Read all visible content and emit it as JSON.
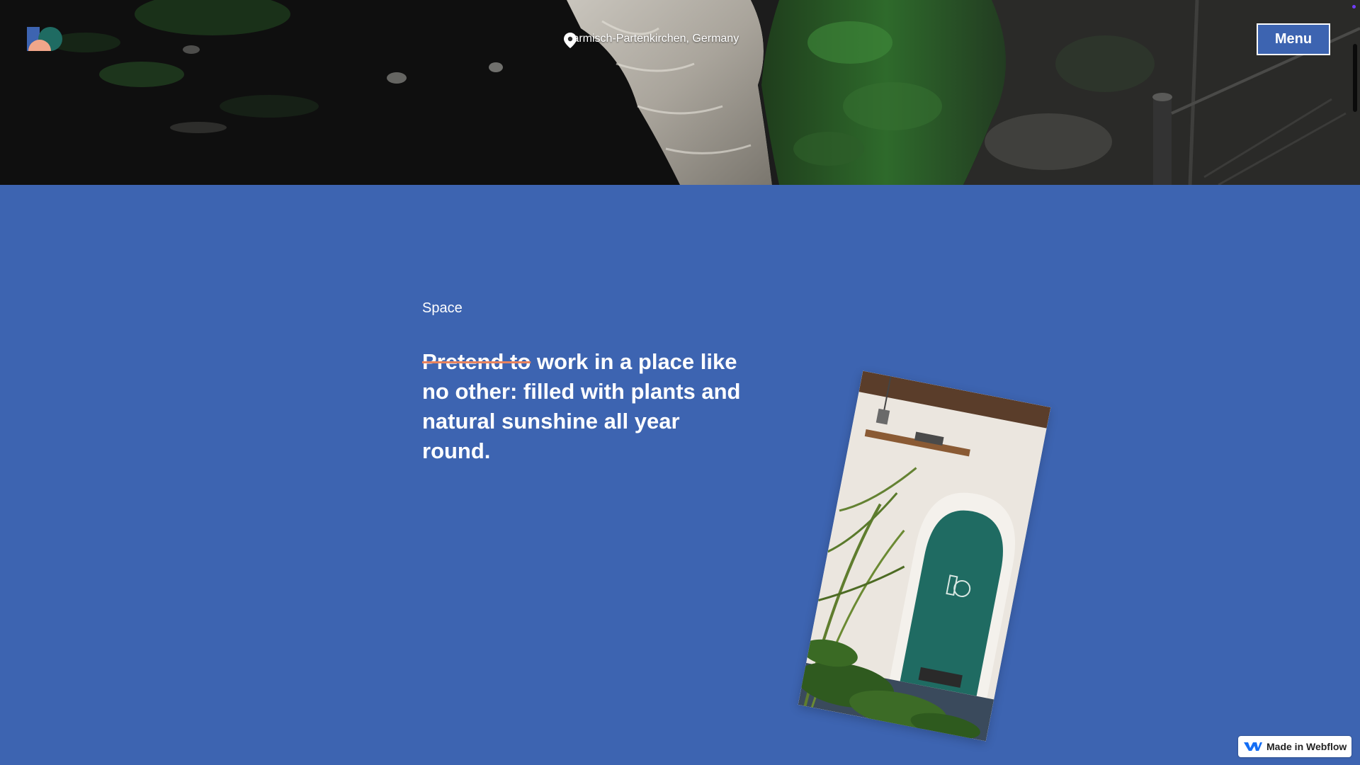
{
  "header": {
    "location": "Garmisch-Partenkirchen, Germany",
    "menu_label": "Menu"
  },
  "section": {
    "eyebrow": "Space",
    "headline_struck": "Pretend to",
    "headline_rest": " work in a place like no other: filled with plants and natural sunshine all year round."
  },
  "badge": {
    "label": "Made in Webflow"
  },
  "colors": {
    "brand_blue": "#3d64b1",
    "strike_accent": "#e8835e",
    "door_teal": "#1f6b62"
  },
  "icons": {
    "logo": "brand-logo",
    "location": "map-pin-icon",
    "badge": "webflow-logo-icon"
  }
}
